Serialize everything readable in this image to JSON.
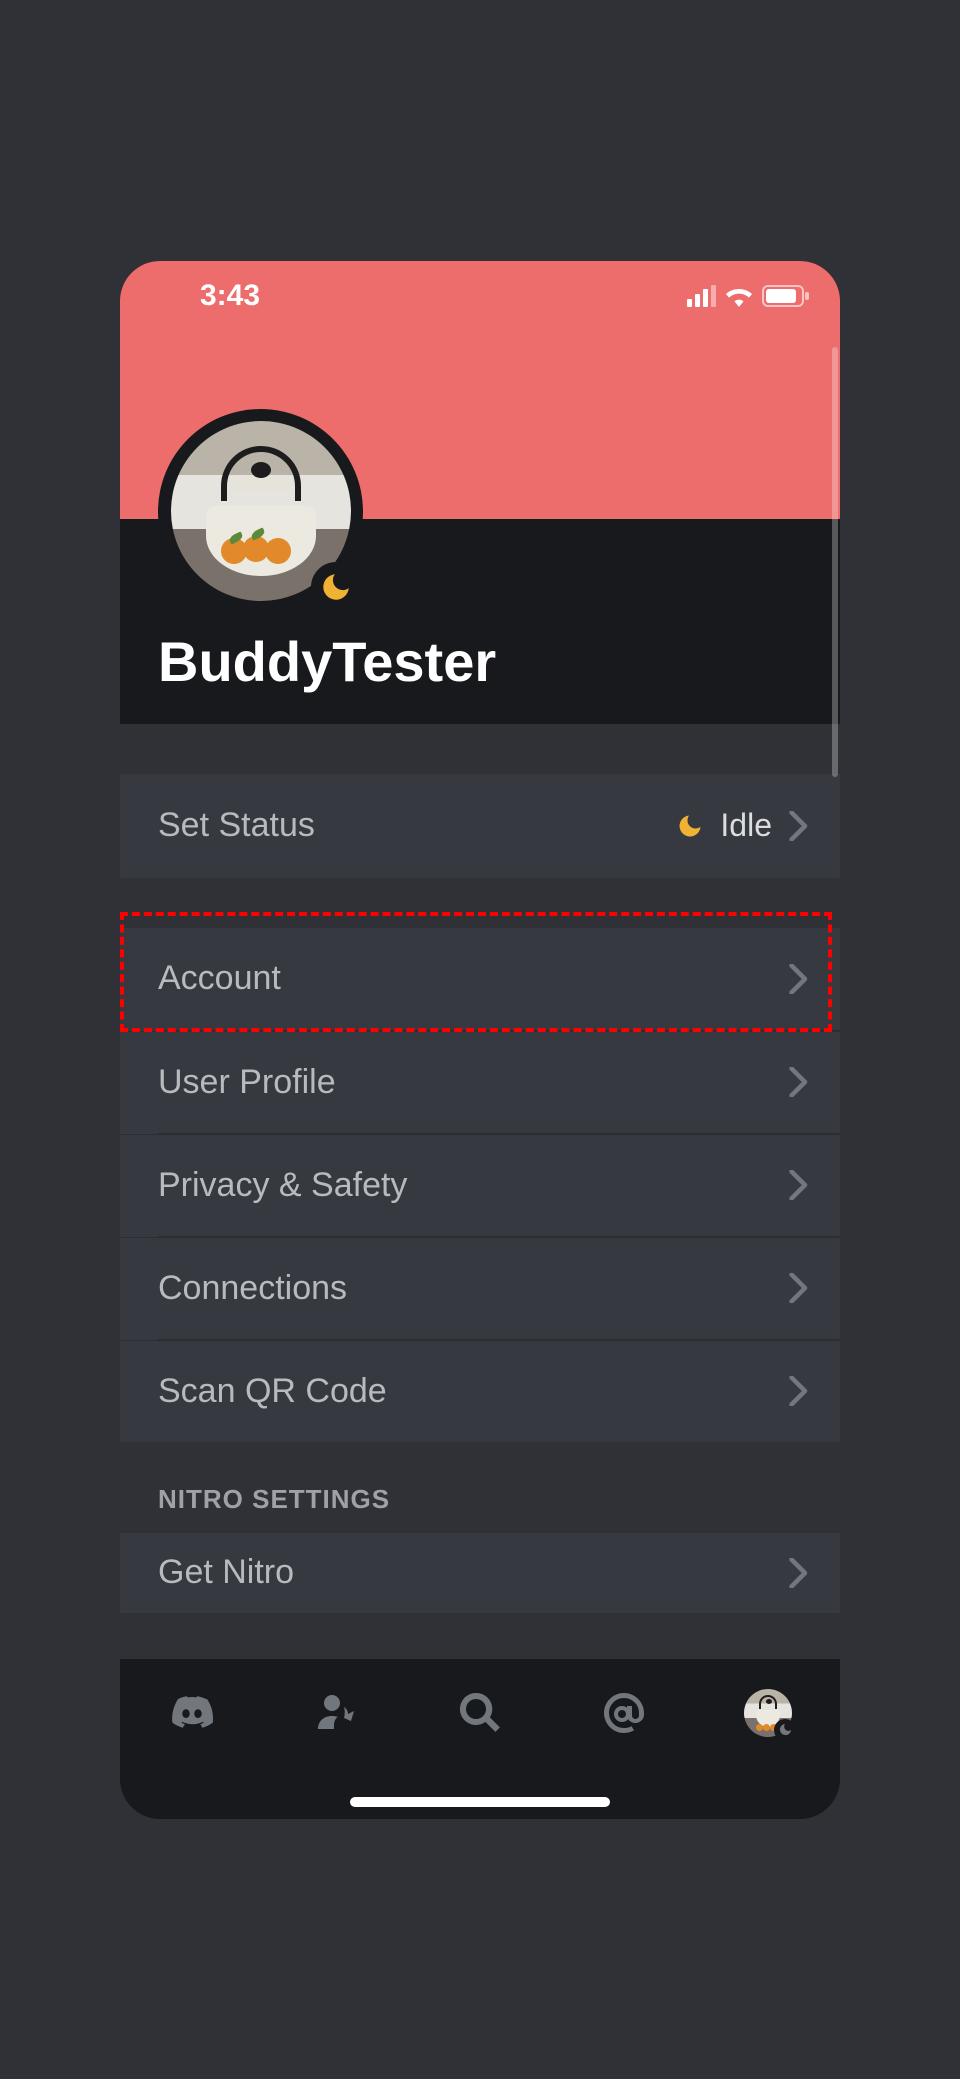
{
  "status_bar": {
    "time": "3:43"
  },
  "profile": {
    "username": "BuddyTester",
    "status_icon": "idle-moon-icon"
  },
  "rows": {
    "set_status": {
      "label": "Set Status",
      "value": "Idle"
    },
    "account": {
      "label": "Account"
    },
    "user_profile": {
      "label": "User Profile"
    },
    "privacy": {
      "label": "Privacy & Safety"
    },
    "connections": {
      "label": "Connections"
    },
    "scan_qr": {
      "label": "Scan QR Code"
    }
  },
  "sections": {
    "nitro_title": "Nitro Settings"
  },
  "nitro": {
    "get_nitro": {
      "label": "Get Nitro"
    }
  },
  "tabs": [
    "discord-logo-icon",
    "friends-icon",
    "search-icon",
    "mentions-icon",
    "profile-avatar"
  ],
  "highlight": {
    "target": "account"
  }
}
